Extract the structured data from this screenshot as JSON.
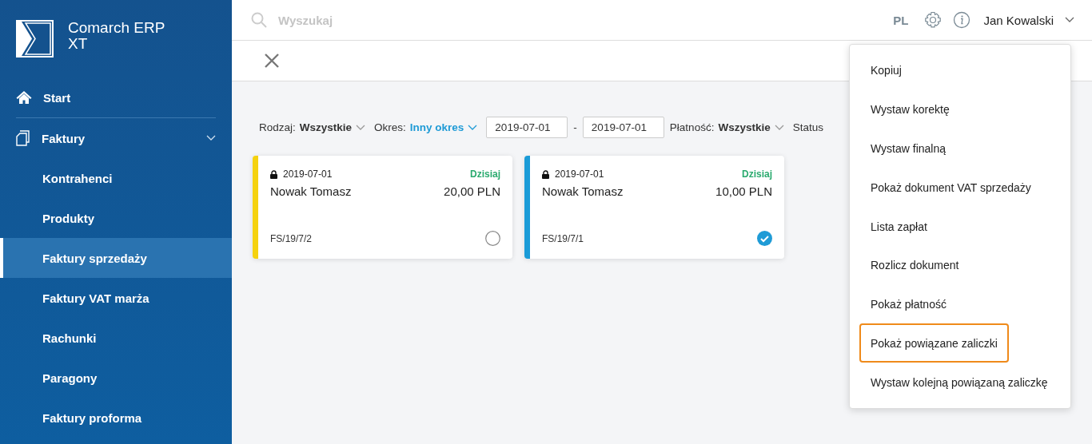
{
  "app": {
    "name": "Comarch ERP XT"
  },
  "sidebar": {
    "items": [
      {
        "label": "Start",
        "selected": false
      },
      {
        "label": "Faktury",
        "expanded": true,
        "selected": false,
        "children": [
          {
            "label": "Kontrahenci",
            "selected": false
          },
          {
            "label": "Produkty",
            "selected": false
          },
          {
            "label": "Faktury sprzedaży",
            "selected": true
          },
          {
            "label": "Faktury VAT marża",
            "selected": false
          },
          {
            "label": "Rachunki",
            "selected": false
          },
          {
            "label": "Paragony",
            "selected": false
          },
          {
            "label": "Faktury proforma",
            "selected": false
          }
        ]
      }
    ]
  },
  "topbar": {
    "search": {
      "placeholder": "Wyszukaj"
    },
    "language": "PL",
    "user": "Jan Kowalski"
  },
  "filters": [
    {
      "kind": "dropdown",
      "label": "Rodzaj:",
      "value": "Wszystkie",
      "active": false
    },
    {
      "kind": "dropdown",
      "label": "Okres:",
      "value": "Inny okres",
      "active": true
    },
    {
      "kind": "date",
      "value": "2019-07-01"
    },
    {
      "kind": "separator",
      "text": "-"
    },
    {
      "kind": "date",
      "value": "2019-07-01"
    },
    {
      "kind": "dropdown",
      "label": "Płatność:",
      "value": "Wszystkie",
      "active": false
    },
    {
      "kind": "text",
      "text": "Status"
    }
  ],
  "cards": [
    {
      "color": "#f5d20f",
      "date": "2019-07-01",
      "badge": "Dzisiaj",
      "name": "Nowak Tomasz",
      "amount": "20,00 PLN",
      "number": "FS/19/7/2",
      "selected": false
    },
    {
      "color": "#1a9bd7",
      "date": "2019-07-01",
      "badge": "Dzisiaj",
      "name": "Nowak Tomasz",
      "amount": "10,00 PLN",
      "number": "FS/19/7/1",
      "selected": true
    }
  ],
  "context_menu": {
    "items": [
      {
        "label": "Kopiuj",
        "highlighted": false
      },
      {
        "label": "Wystaw korektę",
        "highlighted": false
      },
      {
        "label": "Wystaw finalną",
        "highlighted": false
      },
      {
        "label": "Pokaż dokument VAT sprzedaży",
        "highlighted": false
      },
      {
        "label": "Lista zapłat",
        "highlighted": false
      },
      {
        "label": "Rozlicz dokument",
        "highlighted": false
      },
      {
        "label": "Pokaż płatność",
        "highlighted": false
      },
      {
        "label": "Pokaż powiązane zaliczki",
        "highlighted": true
      },
      {
        "label": "Wystaw kolejną powiązaną zaliczkę",
        "highlighted": false
      }
    ]
  }
}
